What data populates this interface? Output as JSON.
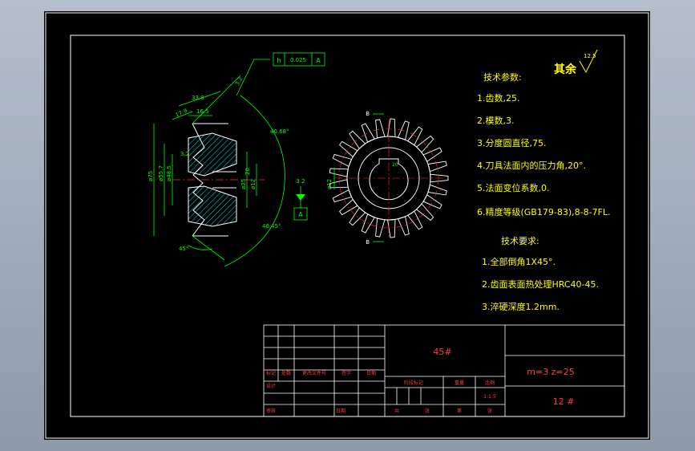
{
  "colors": {
    "viewport": "#9aa6b4",
    "paper": "#000000",
    "frame": "#ffffff",
    "outline": "#ffffff",
    "dimension": "#00ff00",
    "hatch": "#00c8c8",
    "centerline": "#ff3030",
    "text": "#ffff00",
    "titleblock_text": "#ff4040"
  },
  "drawing": {
    "dimensions": {
      "top_gap": "0.025",
      "tol_h": "h",
      "tol_a": "A",
      "chamfer_angle": "3.2",
      "d33": "33.8",
      "d17": "17.9",
      "d16": "16.5",
      "d40": "40.68°",
      "d75": "ø75",
      "d55": "ø55.7",
      "d48": "ø48.5",
      "d3_2": "3.2",
      "d20": "20",
      "d25": "ø25",
      "d12": "ø12",
      "angle_bottom": "45°",
      "angle_right": "48.45°",
      "roughness_right": "3.2",
      "datum_a": "A",
      "section_b_top": "B",
      "section_b_bottom": "B",
      "bore_d": "ø12",
      "keyway": "20"
    }
  },
  "notes": {
    "surface_label": "其余",
    "surface_value": "12.5",
    "tech_params_title": "技术参数:",
    "params": [
      "1.齿数,25.",
      "2.模数,3.",
      "3.分度圆直径,75.",
      "4.刀具法面内的压力角,20°.",
      "5.法面变位系数,0.",
      "6.精度等级(GB179-83),8-8-7FL."
    ],
    "tech_req_title": "技术要求:",
    "reqs": [
      "1.全部倒角1X45°.",
      "2.齿面表面热处理HRC40-45.",
      "3.淬硬深度1.2mm."
    ]
  },
  "title_block": {
    "material": "45#",
    "spec": "m=3  z=25",
    "drawing_no": "12 #",
    "headers": [
      "标记",
      "处数",
      "更改文件号",
      "签字",
      "日期"
    ],
    "row_design": "设计",
    "row_approve": "审核",
    "stage_label": "阶段标记",
    "weight_label": "重量",
    "scale_label": "比例",
    "scale_value": "1:1.5",
    "sheet_label": "共",
    "sheet_of": "张",
    "page_label": "第",
    "page_of": "张",
    "date_label": "日期"
  }
}
